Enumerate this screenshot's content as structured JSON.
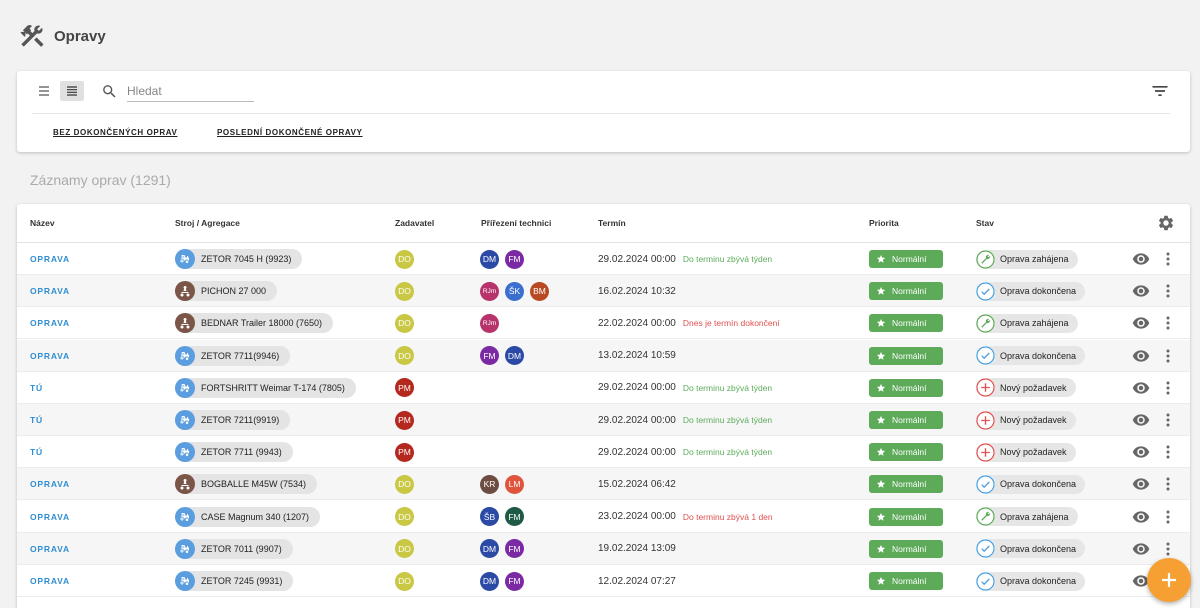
{
  "header": {
    "title": "Opravy",
    "icon": "tools-icon"
  },
  "search": {
    "placeholder": "Hledat"
  },
  "quick_filters": [
    {
      "label": "Bez dokončených oprav"
    },
    {
      "label": "Poslední dokončené opravy"
    }
  ],
  "records_title": "Záznamy oprav (1291)",
  "columns": {
    "name": "Název",
    "machine": "Stroj / Agregace",
    "requester": "Zadavatel",
    "technicians": "Přířezení technici",
    "deadline": "Termín",
    "priority": "Priorita",
    "status": "Stav"
  },
  "colors": {
    "link": "#2f8ed1",
    "priority_green": "#5daa59",
    "fab_orange": "#f6a033",
    "note_ok": "#5cab5c",
    "note_warn": "#e05050",
    "tractor_blue": "#5b9ee0",
    "implement_brown": "#7a5548",
    "requester_do": "#c8c844",
    "requester_pm": "#b5281e"
  },
  "rows": [
    {
      "name": "OPRAVA",
      "machine": "ZETOR 7045 H (9923)",
      "machine_type": "tractor",
      "requester": "DO",
      "techs": [
        {
          "i": "DM",
          "c": "#2b4aa5"
        },
        {
          "i": "FM",
          "c": "#7b2aa3"
        }
      ],
      "date": "29.02.2024 00:00",
      "note": "Do terminu zbývá týden",
      "note_type": "ok",
      "priority": "Normální",
      "status": "Oprava zahájena",
      "status_type": "started"
    },
    {
      "name": "OPRAVA",
      "machine": "PICHON 27 000",
      "machine_type": "implement",
      "requester": "DO",
      "techs": [
        {
          "i": "RJm",
          "c": "#b8336a",
          "small": true
        },
        {
          "i": "ŠK",
          "c": "#3a6fd0"
        },
        {
          "i": "BM",
          "c": "#b74a22"
        }
      ],
      "date": "16.02.2024 10:32",
      "note": "",
      "note_type": "",
      "priority": "Normální",
      "status": "Oprava dokončena",
      "status_type": "done"
    },
    {
      "name": "OPRAVA",
      "machine": "BEDNAR Trailer 18000 (7650)",
      "machine_type": "implement",
      "requester": "DO",
      "techs": [
        {
          "i": "RJm",
          "c": "#b8336a",
          "small": true
        }
      ],
      "date": "22.02.2024 00:00",
      "note": "Dnes je termín dokončení",
      "note_type": "warn",
      "priority": "Normální",
      "status": "Oprava zahájena",
      "status_type": "started"
    },
    {
      "name": "OPRAVA",
      "machine": "ZETOR 7711(9946)",
      "machine_type": "tractor",
      "requester": "DO",
      "techs": [
        {
          "i": "FM",
          "c": "#7b2aa3"
        },
        {
          "i": "DM",
          "c": "#2b4aa5"
        }
      ],
      "date": "13.02.2024 10:59",
      "note": "",
      "note_type": "",
      "priority": "Normální",
      "status": "Oprava dokončena",
      "status_type": "done"
    },
    {
      "name": "TÚ",
      "machine": "FORTSHRITT Weimar T-174 (7805)",
      "machine_type": "tractor",
      "requester": "PM",
      "techs": [],
      "date": "29.02.2024 00:00",
      "note": "Do terminu zbývá týden",
      "note_type": "ok",
      "priority": "Normální",
      "status": "Nový požadavek",
      "status_type": "new"
    },
    {
      "name": "TÚ",
      "machine": "ZETOR 7211(9919)",
      "machine_type": "tractor",
      "requester": "PM",
      "techs": [],
      "date": "29.02.2024 00:00",
      "note": "Do terminu zbývá týden",
      "note_type": "ok",
      "priority": "Normální",
      "status": "Nový požadavek",
      "status_type": "new"
    },
    {
      "name": "TÚ",
      "machine": "ZETOR 7711 (9943)",
      "machine_type": "tractor",
      "requester": "PM",
      "techs": [],
      "date": "29.02.2024 00:00",
      "note": "Do terminu zbývá týden",
      "note_type": "ok",
      "priority": "Normální",
      "status": "Nový požadavek",
      "status_type": "new"
    },
    {
      "name": "OPRAVA",
      "machine": "BOGBALLE M45W (7534)",
      "machine_type": "implement",
      "requester": "DO",
      "techs": [
        {
          "i": "KR",
          "c": "#6d4c41"
        },
        {
          "i": "LM",
          "c": "#e0543c"
        }
      ],
      "date": "15.02.2024 06:42",
      "note": "",
      "note_type": "",
      "priority": "Normální",
      "status": "Oprava dokončena",
      "status_type": "done"
    },
    {
      "name": "OPRAVA",
      "machine": "CASE Magnum 340 (1207)",
      "machine_type": "tractor",
      "requester": "DO",
      "techs": [
        {
          "i": "ŠB",
          "c": "#2b4aa5"
        },
        {
          "i": "FM",
          "c": "#1f5a45"
        }
      ],
      "date": "23.02.2024 00:00",
      "note": "Do terminu zbývá 1 den",
      "note_type": "warn",
      "priority": "Normální",
      "status": "Oprava zahájena",
      "status_type": "started"
    },
    {
      "name": "OPRAVA",
      "machine": "ZETOR 7011 (9907)",
      "machine_type": "tractor",
      "requester": "DO",
      "techs": [
        {
          "i": "DM",
          "c": "#2b4aa5"
        },
        {
          "i": "FM",
          "c": "#7b2aa3"
        }
      ],
      "date": "19.02.2024 13:09",
      "note": "",
      "note_type": "",
      "priority": "Normální",
      "status": "Oprava dokončena",
      "status_type": "done"
    },
    {
      "name": "OPRAVA",
      "machine": "ZETOR 7245 (9931)",
      "machine_type": "tractor",
      "requester": "DO",
      "techs": [
        {
          "i": "DM",
          "c": "#2b4aa5"
        },
        {
          "i": "FM",
          "c": "#7b2aa3"
        }
      ],
      "date": "12.02.2024 07:27",
      "note": "",
      "note_type": "",
      "priority": "Normální",
      "status": "Oprava dokončena",
      "status_type": "done"
    }
  ]
}
